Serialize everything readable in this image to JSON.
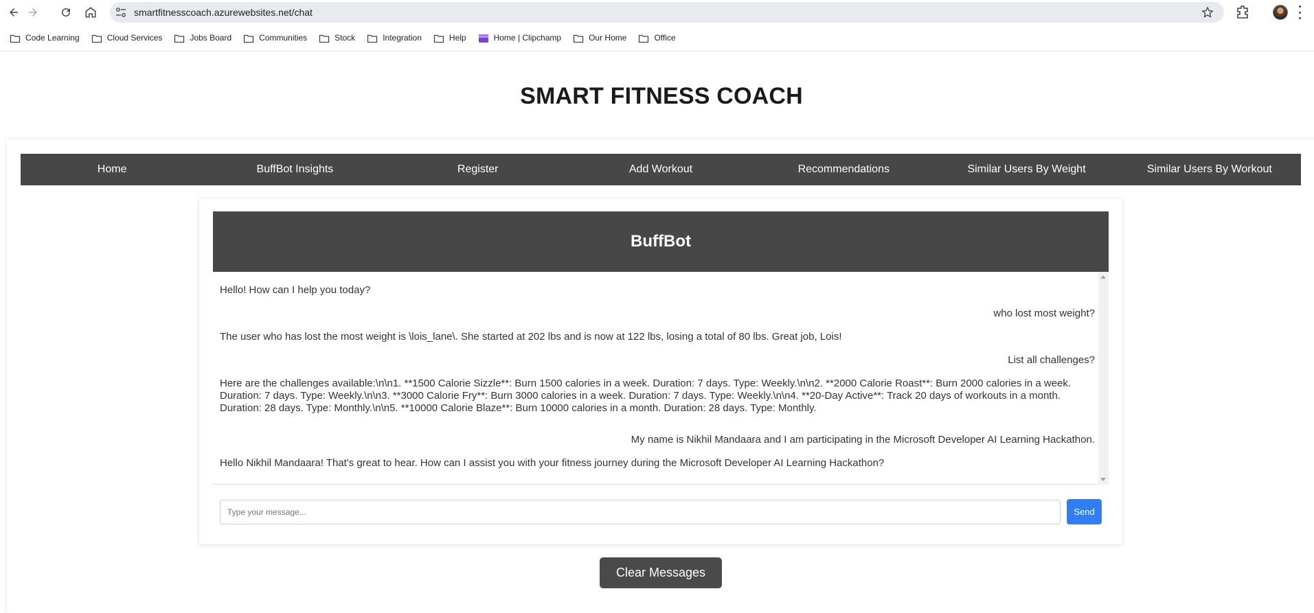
{
  "browser": {
    "url": "smartfitnesscoach.azurewebsites.net/chat",
    "bookmarks": [
      {
        "label": "Code Learning",
        "icon": "folder-icon"
      },
      {
        "label": "Cloud Services",
        "icon": "folder-icon"
      },
      {
        "label": "Jobs Board",
        "icon": "folder-icon"
      },
      {
        "label": "Communities",
        "icon": "folder-icon"
      },
      {
        "label": "Stock",
        "icon": "folder-icon"
      },
      {
        "label": "Integration",
        "icon": "folder-icon"
      },
      {
        "label": "Help",
        "icon": "folder-icon"
      },
      {
        "label": "Home | Clipchamp",
        "icon": "clipchamp-icon"
      },
      {
        "label": "Our Home",
        "icon": "folder-icon"
      },
      {
        "label": "Office",
        "icon": "folder-icon"
      }
    ]
  },
  "page": {
    "title": "SMART FITNESS COACH"
  },
  "nav": {
    "items": [
      {
        "label": "Home"
      },
      {
        "label": "BuffBot Insights"
      },
      {
        "label": "Register"
      },
      {
        "label": "Add Workout"
      },
      {
        "label": "Recommendations"
      },
      {
        "label": "Similar Users By Weight"
      },
      {
        "label": "Similar Users By Workout"
      }
    ]
  },
  "chat": {
    "title": "BuffBot",
    "messages": [
      {
        "role": "bot",
        "text": "Hello! How can I help you today?"
      },
      {
        "role": "user",
        "text": "who lost most weight?"
      },
      {
        "role": "bot",
        "text": "The user who has lost the most weight is \\lois_lane\\. She started at 202 lbs and is now at 122 lbs, losing a total of 80 lbs. Great job, Lois!"
      },
      {
        "role": "user",
        "text": "List all challenges?"
      },
      {
        "role": "bot",
        "text": "Here are the challenges available:\\n\\n1. **1500 Calorie Sizzle**: Burn 1500 calories in a week. Duration: 7 days. Type: Weekly.\\n\\n2. **2000 Calorie Roast**: Burn 2000 calories in a week. Duration: 7 days. Type: Weekly.\\n\\n3. **3000 Calorie Fry**: Burn 3000 calories in a week. Duration: 7 days. Type: Weekly.\\n\\n4. **20-Day Active**: Track 20 days of workouts in a month. Duration: 28 days. Type: Monthly.\\n\\n5. **10000 Calorie Blaze**: Burn 10000 calories in a month. Duration: 28 days. Type: Monthly."
      },
      {
        "role": "user",
        "text": "My name is Nikhil Mandaara and I am participating in the Microsoft Developer AI Learning Hackathon."
      },
      {
        "role": "bot",
        "text": "Hello Nikhil Mandaara! That's great to hear. How can I assist you with your fitness journey during the Microsoft Developer AI Learning Hackathon?"
      }
    ],
    "input_placeholder": "Type your message...",
    "input_value": "",
    "send_label": "Send"
  },
  "clear_label": "Clear Messages",
  "colors": {
    "nav_bg": "#474747",
    "send_btn": "#2f7ef6",
    "clear_btn": "#4a4a4a"
  }
}
